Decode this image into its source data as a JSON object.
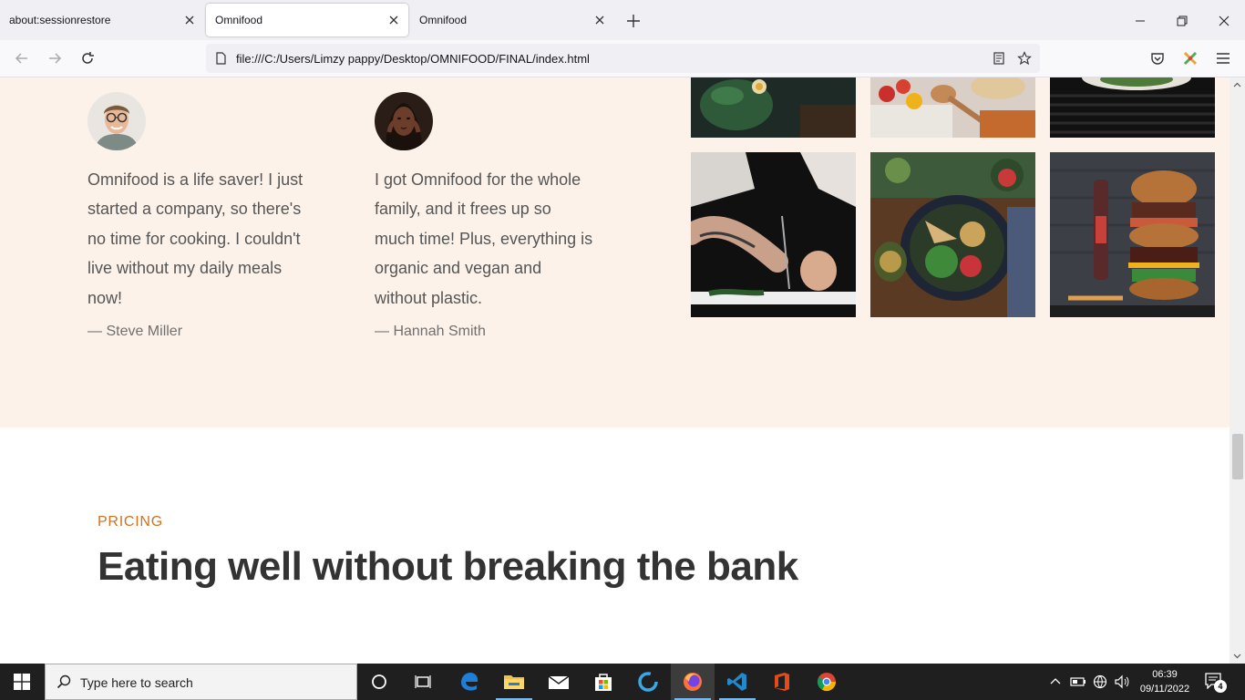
{
  "browser": {
    "tabs": [
      {
        "title": "about:sessionrestore",
        "active": false
      },
      {
        "title": "Omnifood",
        "active": true
      },
      {
        "title": "Omnifood",
        "active": false
      }
    ],
    "url": "file:///C:/Users/Limzy pappy/Desktop/OMNIFOOD/FINAL/index.html"
  },
  "testimonials": [
    {
      "text": "Omnifood is a life saver! I just started a company, so there's no time for cooking. I couldn't live without my daily meals now!",
      "author": "— Steve Miller"
    },
    {
      "text": "I got Omnifood for the whole family, and it frees up so much time! Plus, everything is organic and vegan and without plastic.",
      "author": "— Hannah Smith"
    }
  ],
  "pricing": {
    "subheading": "PRICING",
    "heading": "Eating well without breaking the bank"
  },
  "taskbar": {
    "search_placeholder": "Type here to search",
    "time": "06:39",
    "date": "09/11/2022",
    "notifications": "4"
  },
  "colors": {
    "section_bg": "#fdf2e9",
    "accent": "#cf711f",
    "heading": "#333333"
  }
}
